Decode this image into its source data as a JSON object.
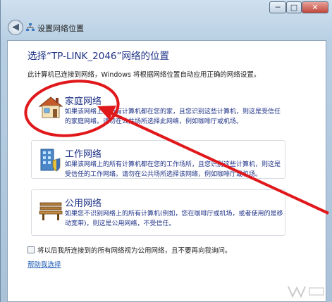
{
  "window": {
    "title": "设置网络位置",
    "buttons": {
      "minimize": "─",
      "maximize": "□",
      "close": "✕"
    },
    "icons": {
      "back": "back-arrow-icon",
      "network": "network-icon"
    }
  },
  "main": {
    "heading": "选择“TP-LINK_2046”网络的位置",
    "description": "此计算机已连接到网络，Windows 将根据网络位置自动应用正确的网络设置。",
    "options": [
      {
        "title": "家庭网络",
        "description": "如果该网络上的所有计算机都在您的家，且您识别这些计算机，则这是受信任的家庭网络。请勿在公共场所选择此网络，例如咖啡厅或机场。",
        "icon": "house-icon"
      },
      {
        "title": "工作网络",
        "description": "如果该网络上的所有计算机都在您的工作场所，且您识别这些计算机，则这是受信任的工作网络。请勿在公共场所选择该网络，例如咖啡厅或机场。",
        "icon": "office-building-icon"
      },
      {
        "title": "公用网络",
        "description": "如果您不识别网络上的所有计算机(例如，您在咖啡厅或机场，或者使用的是移动宽带)，则这是公用网络，不受信任。",
        "icon": "park-bench-icon"
      }
    ],
    "checkbox_label": "将以后我所连接到的所有网络视为公用网络，且不要再向我询问。",
    "help_link": "帮助我选择"
  },
  "annotations": {
    "circle_color": "#e0181b",
    "arrow_color": "#e0181b"
  }
}
